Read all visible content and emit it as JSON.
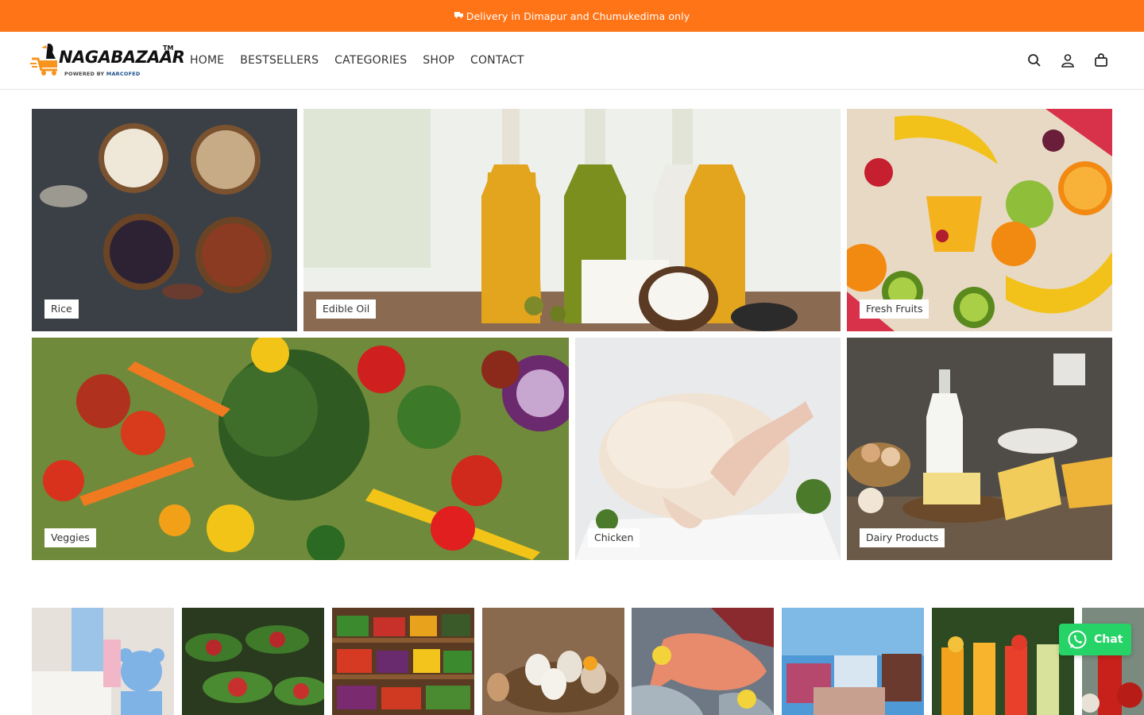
{
  "announcement": "Delivery in Dimapur and Chumukedima only",
  "logo": {
    "wordmark": "NAGABAZAAR",
    "trademark": "TM",
    "powered_by": "POWERED BY",
    "partner": "MARCOFED"
  },
  "nav": {
    "items": [
      "HOME",
      "BESTSELLERS",
      "CATEGORIES",
      "SHOP",
      "CONTACT"
    ]
  },
  "header_icons": [
    "search-icon",
    "account-icon",
    "cart-icon"
  ],
  "collections": [
    {
      "label": "Rice"
    },
    {
      "label": "Edible Oil"
    },
    {
      "label": "Fresh Fruits"
    },
    {
      "label": "Veggies"
    },
    {
      "label": "Chicken"
    },
    {
      "label": "Dairy Products"
    }
  ],
  "chat": {
    "label": "Chat"
  },
  "colors": {
    "announcement_bg": "#ff7417",
    "chat_bg": "#25d366",
    "logo_accent": "#f7941d"
  }
}
